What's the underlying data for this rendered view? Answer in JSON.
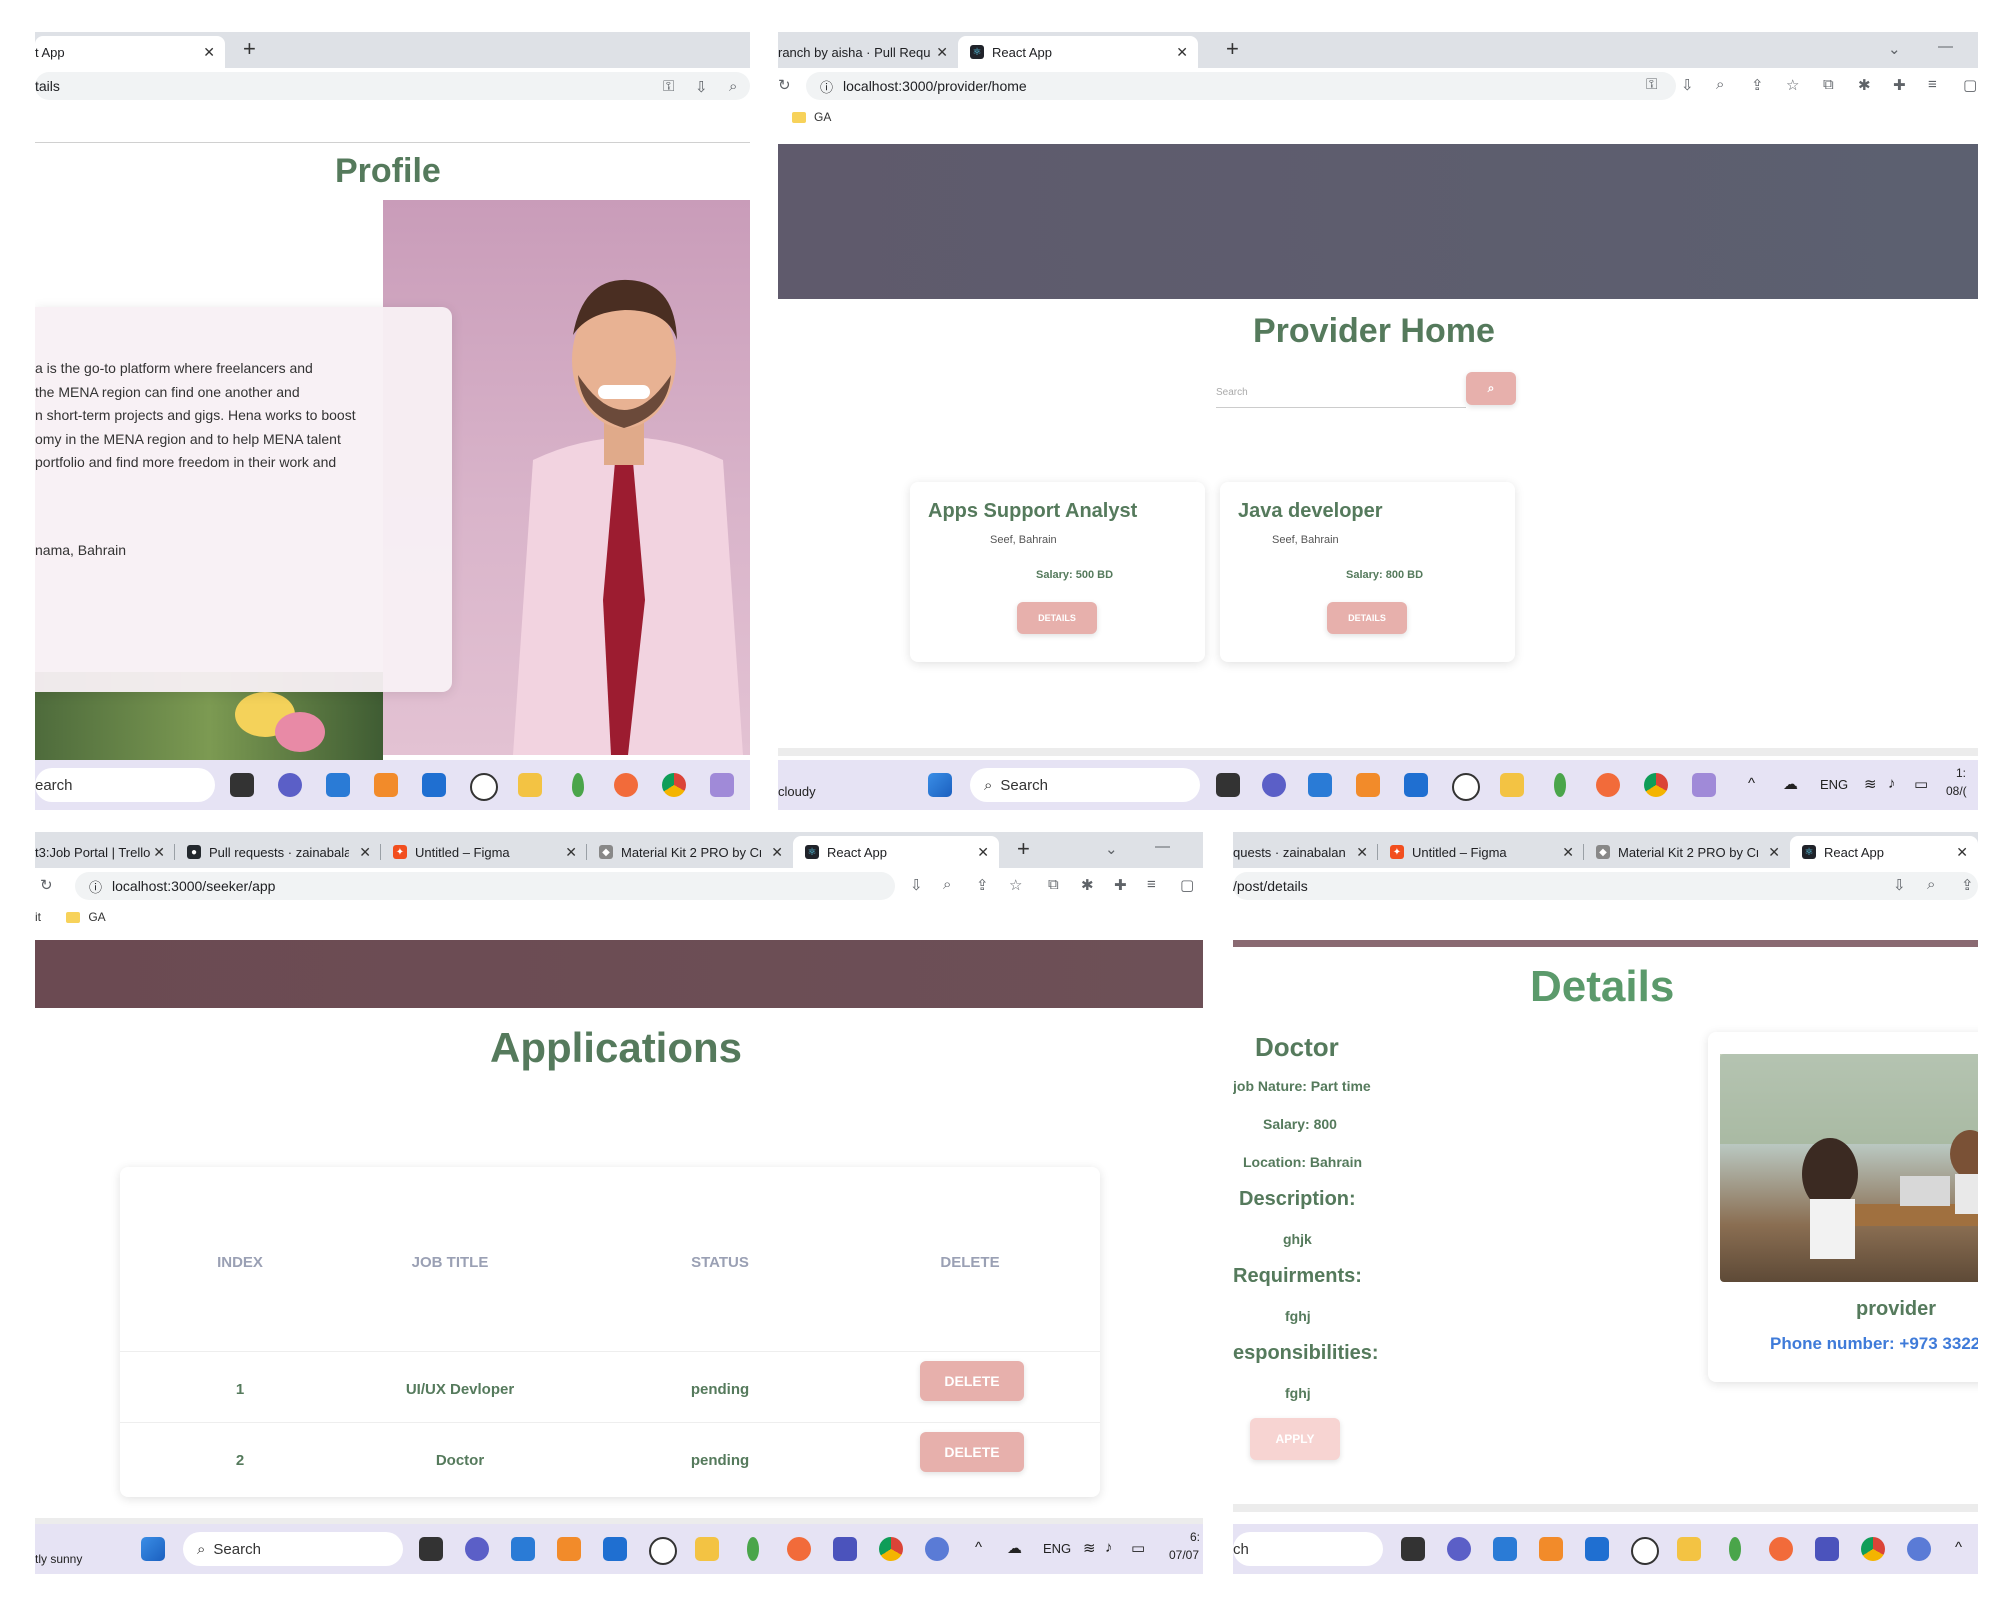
{
  "profile_window": {
    "tab_label": "t App",
    "url": "tails",
    "heading": "Profile",
    "bio_lines": [
      "a is the go-to platform where freelancers and",
      " the MENA region can find one another and",
      "n short-term projects and gigs. Hena works to boost",
      "omy in the MENA region and to help MENA talent",
      "portfolio and find more freedom in their work and"
    ],
    "location": "nama, Bahrain",
    "taskbar_search": "earch"
  },
  "provider_window": {
    "tabs": [
      "ranch by aisha · Pull Requ",
      "React App"
    ],
    "url": "localhost:3000/provider/home",
    "bookmark": "GA",
    "heading": "Provider Home",
    "search_placeholder": "Search",
    "jobs": [
      {
        "title": "Apps Support Analyst",
        "location": "Seef, Bahrain",
        "salary": "Salary: 500 BD",
        "button": "DETAILS"
      },
      {
        "title": "Java developer",
        "location": "Seef, Bahrain",
        "salary": "Salary: 800 BD",
        "button": "DETAILS"
      }
    ],
    "taskbar": {
      "weather": "cloudy",
      "search": "Search",
      "lang": "ENG",
      "time": "1:",
      "date": "08/("
    }
  },
  "seeker_window": {
    "tabs": [
      "t3:Job Portal | Trello",
      "Pull requests · zainabalan",
      "Untitled – Figma",
      "Material Kit 2 PRO by Cre",
      "React App"
    ],
    "url": "localhost:3000/seeker/app",
    "bookmarks": [
      "it",
      "GA"
    ],
    "heading": "Applications",
    "table": {
      "headers": [
        "INDEX",
        "JOB TITLE",
        "STATUS",
        "DELETE"
      ],
      "rows": [
        {
          "index": "1",
          "job_title": "UI/UX Devloper",
          "status": "pending",
          "action": "DELETE"
        },
        {
          "index": "2",
          "job_title": "Doctor",
          "status": "pending",
          "action": "DELETE"
        }
      ]
    },
    "taskbar": {
      "weather": "tly sunny",
      "search": "Search",
      "lang": "ENG",
      "time": "6:",
      "date": "07/07"
    }
  },
  "details_window": {
    "tabs": [
      "quests · zainabalan",
      "Untitled – Figma",
      "Material Kit 2 PRO by Cre",
      "React App"
    ],
    "url": "/post/details",
    "heading": "Details",
    "job_title": "Doctor",
    "job_nature": "job Nature: Part time",
    "salary": "Salary: 800",
    "location": "Location: Bahrain",
    "description_label": "Description:",
    "description": "ghjk",
    "requirements_label": "Requirments:",
    "requirements": "fghj",
    "responsibilities_label": "esponsibilities:",
    "responsibilities": "fghj",
    "apply_button": "APPLY",
    "provider_name": "provider",
    "provider_phone": "Phone number: +973 3322",
    "taskbar_search": "ch"
  },
  "colors": {
    "heading_green": "#557a5c",
    "button_pink": "#e7b0ac",
    "header_band_grey": "#5f5c6e",
    "header_band_mauve": "#6b4d53"
  }
}
